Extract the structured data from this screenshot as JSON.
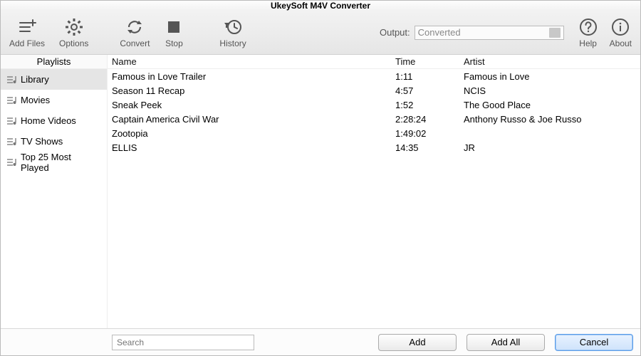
{
  "window_title": "UkeySoft M4V Converter",
  "toolbar": {
    "add_files": "Add Files",
    "options": "Options",
    "convert": "Convert",
    "stop": "Stop",
    "history": "History",
    "output_label": "Output:",
    "output_value": "Converted",
    "help": "Help",
    "about": "About"
  },
  "sidebar": {
    "header": "Playlists",
    "items": [
      {
        "label": "Library"
      },
      {
        "label": "Movies"
      },
      {
        "label": "Home Videos"
      },
      {
        "label": "TV Shows"
      },
      {
        "label": "Top 25 Most Played"
      }
    ],
    "selected_index": 0
  },
  "list": {
    "headers": {
      "name": "Name",
      "time": "Time",
      "artist": "Artist"
    },
    "rows": [
      {
        "name": "Famous in Love  Trailer",
        "time": "1:11",
        "artist": "Famous in Love"
      },
      {
        "name": "Season 11 Recap",
        "time": "4:57",
        "artist": "NCIS"
      },
      {
        "name": "Sneak Peek",
        "time": "1:52",
        "artist": "The Good Place"
      },
      {
        "name": "Captain America  Civil War",
        "time": "2:28:24",
        "artist": "Anthony Russo & Joe Russo"
      },
      {
        "name": "Zootopia",
        "time": "1:49:02",
        "artist": ""
      },
      {
        "name": "ELLIS",
        "time": "14:35",
        "artist": "JR"
      }
    ]
  },
  "footer": {
    "search_placeholder": "Search",
    "add": "Add",
    "add_all": "Add All",
    "cancel": "Cancel"
  },
  "colors": {
    "selected_bg": "#e5e5e5",
    "primary_border": "#5b9de8"
  }
}
